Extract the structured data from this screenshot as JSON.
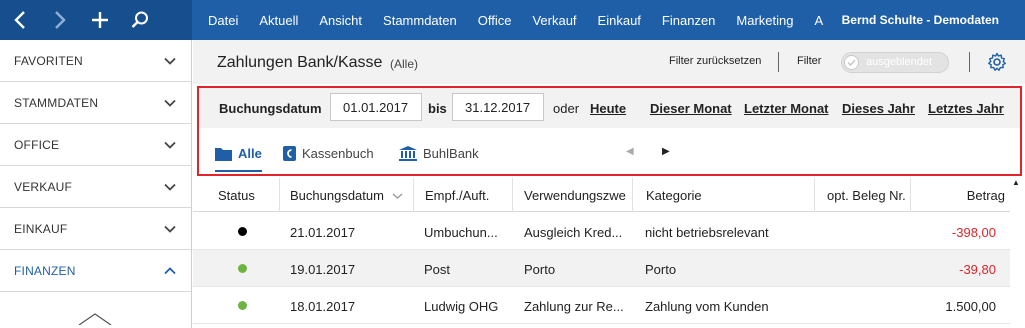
{
  "topbar": {
    "menu": [
      "Datei",
      "Aktuell",
      "Ansicht",
      "Stammdaten",
      "Office",
      "Verkauf",
      "Einkauf",
      "Finanzen",
      "Marketing"
    ],
    "menu_cut": "A",
    "user": "Bernd Schulte - Demodaten"
  },
  "sidebar": {
    "items": [
      {
        "label": "FAVORITEN",
        "state": "collapsed"
      },
      {
        "label": "STAMMDATEN",
        "state": "collapsed"
      },
      {
        "label": "OFFICE",
        "state": "collapsed"
      },
      {
        "label": "VERKAUF",
        "state": "collapsed"
      },
      {
        "label": "EINKAUF",
        "state": "collapsed"
      },
      {
        "label": "FINANZEN",
        "state": "expanded"
      }
    ]
  },
  "header": {
    "title": "Zahlungen Bank/Kasse",
    "subtitle": "(Alle)",
    "reset_label": "Filter zurücksetzen",
    "filter_label": "Filter",
    "toggle_label": "ausgeblendet"
  },
  "filter": {
    "date_label": "Buchungsdatum",
    "from": "01.01.2017",
    "bis_label": "bis",
    "to": "31.12.2017",
    "oder_label": "oder",
    "quick_links": [
      "Heute",
      "Dieser Monat",
      "Letzter Monat",
      "Dieses Jahr",
      "Letztes Jahr"
    ]
  },
  "tabs": [
    {
      "label": "Alle",
      "icon": "folder-icon",
      "active": true
    },
    {
      "label": "Kassenbuch",
      "icon": "cashbook-icon",
      "active": false
    },
    {
      "label": "BuhlBank",
      "icon": "bank-icon",
      "active": false
    }
  ],
  "table": {
    "columns": [
      "Status",
      "Buchungsdatum",
      "Empf./Auft.",
      "Verwendungszwe",
      "Kategorie",
      "opt. Beleg Nr.",
      "Betrag"
    ],
    "rows": [
      {
        "status": "black",
        "date": "21.01.2017",
        "party": "Umbuchun...",
        "purpose": "Ausgleich Kred...",
        "category": "nicht betriebsrelevant",
        "receipt": "",
        "amount": "-398,00",
        "negative": true
      },
      {
        "status": "green",
        "date": "19.01.2017",
        "party": "Post",
        "purpose": "Porto",
        "category": "Porto",
        "receipt": "",
        "amount": "-39,80",
        "negative": true
      },
      {
        "status": "green",
        "date": "18.01.2017",
        "party": "Ludwig OHG",
        "purpose": "Zahlung zur Re...",
        "category": "Zahlung vom Kunden",
        "receipt": "",
        "amount": "1.500,00",
        "negative": false
      }
    ]
  },
  "colors": {
    "brand_blue": "#1f5fa8",
    "highlight_red": "#e0242a",
    "status_green": "#6db33f",
    "status_black": "#000000"
  }
}
